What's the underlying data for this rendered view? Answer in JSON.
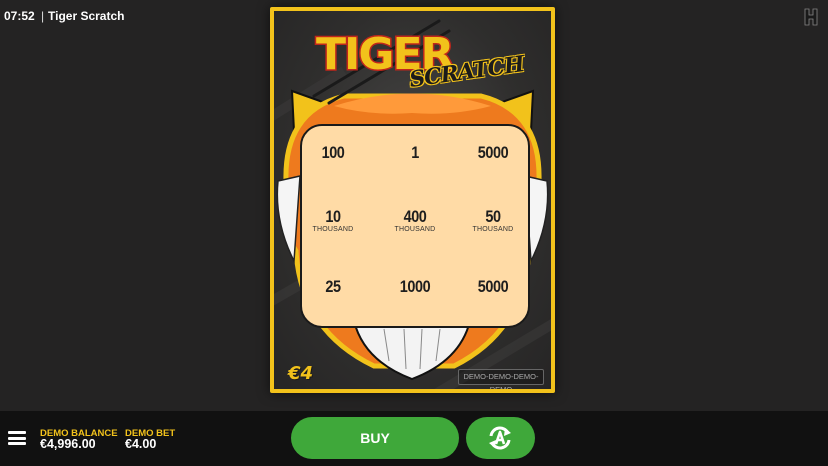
{
  "header": {
    "time": "07:52",
    "separator": "|",
    "game_title": "Tiger Scratch",
    "provider_logo_icon": "provider-logo-icon"
  },
  "ticket": {
    "logo_text_tiger": "TIGER",
    "logo_text_scratch": "SCRATCH",
    "price": "€4",
    "demo_watermark": "DEMO-DEMO-DEMO-DEMO",
    "cells": [
      {
        "value": "100",
        "unit": ""
      },
      {
        "value": "1",
        "unit": ""
      },
      {
        "value": "5000",
        "unit": ""
      },
      {
        "value": "10",
        "unit": "THOUSAND"
      },
      {
        "value": "400",
        "unit": "THOUSAND"
      },
      {
        "value": "50",
        "unit": "THOUSAND"
      },
      {
        "value": "25",
        "unit": ""
      },
      {
        "value": "1000",
        "unit": ""
      },
      {
        "value": "5000",
        "unit": ""
      }
    ]
  },
  "footer": {
    "menu_icon": "hamburger-menu-icon",
    "balance_label": "DEMO BALANCE",
    "balance_value": "€4,996.00",
    "bet_label": "DEMO BET",
    "bet_value": "€4.00",
    "buy_label": "BUY",
    "autoplay_icon": "autoplay-icon"
  },
  "colors": {
    "background": "#242323",
    "accent_gold": "#f2c21b",
    "button_green": "#3fa83a",
    "scratch_area": "#ffdba6",
    "footer_bg": "#111111"
  }
}
